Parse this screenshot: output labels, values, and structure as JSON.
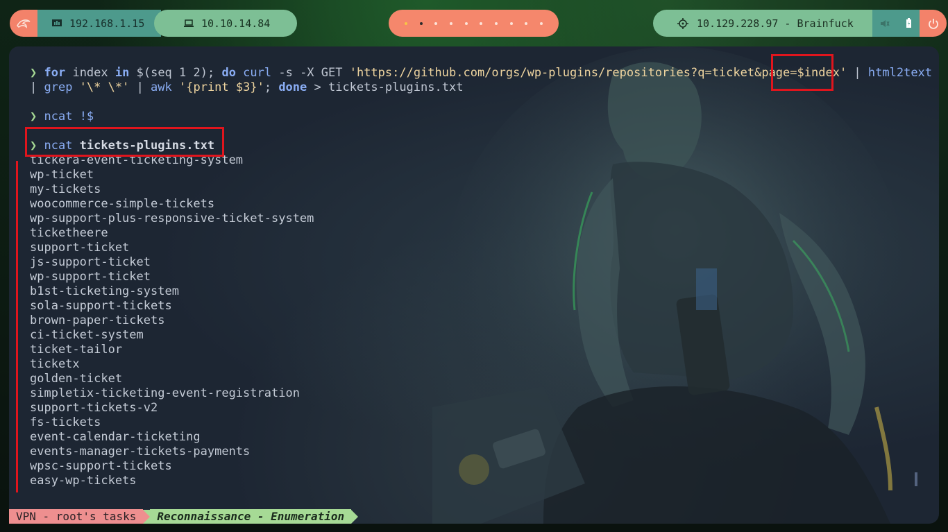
{
  "topbar": {
    "launcher_icon": "kali-dragon-icon",
    "local_ip": "192.168.1.15",
    "local_ip_icon": "network-icon",
    "vpn_ip": "10.10.14.84",
    "vpn_ip_icon": "laptop-icon",
    "workspaces": 10,
    "active_workspace": 2,
    "target_icon": "crosshair-icon",
    "target": "10.129.228.97 - Brainfuck",
    "tray_icons": [
      "volume-icon",
      "battery-icon"
    ],
    "power_icon": "power-icon"
  },
  "terminal": {
    "cmd1": {
      "prompt": "❯",
      "for": "for",
      "var": " index ",
      "in": "in",
      "sub_open": " $(",
      "seq": "seq 1 2",
      "sub_close": "); ",
      "do": "do",
      "curl": " curl",
      "curl_args": " -s -X GET ",
      "url_a": "'https://github.com/orgs/wp-plugins/repositories?q=ticket&page=",
      "url_b": "$index",
      "url_c": "'",
      "pipe1": " | ",
      "html2text": "html2text",
      "pipe2": "| ",
      "grep": "grep",
      "grep_arg": " '\\* \\*'",
      "pipe3": " | ",
      "awk": "awk",
      "awk_arg": " '{print $3}'",
      "semi": "; ",
      "done": "done",
      "redirect": " > tickets-plugins.txt"
    },
    "cmd2": {
      "prompt": "❯",
      "cmd": "ncat",
      "arg": " !$"
    },
    "cmd3": {
      "prompt": "❯",
      "cmd": "ncat",
      "arg": " tickets-plugins.txt"
    },
    "output": [
      "tickera-event-ticketing-system",
      "wp-ticket",
      "my-tickets",
      "woocommerce-simple-tickets",
      "wp-support-plus-responsive-ticket-system",
      "ticketheere",
      "support-ticket",
      "js-support-ticket",
      "wp-support-ticket",
      "b1st-ticketing-system",
      "sola-support-tickets",
      "brown-paper-tickets",
      "ci-ticket-system",
      "ticket-tailor",
      "ticketx",
      "golden-ticket",
      "simpletix-ticketing-event-registration",
      "support-tickets-v2",
      "fs-tickets",
      "event-calendar-ticketing",
      "events-manager-tickets-payments",
      "wpsc-support-tickets",
      "easy-wp-tickets"
    ]
  },
  "statusbar": {
    "session": "VPN - root's tasks",
    "window": "Reconnaissance - Enumeration"
  },
  "colors": {
    "highlight": "#e0151d",
    "prompt": "#a6da95",
    "keyword": "#8aadf4",
    "string": "#eed49f"
  }
}
